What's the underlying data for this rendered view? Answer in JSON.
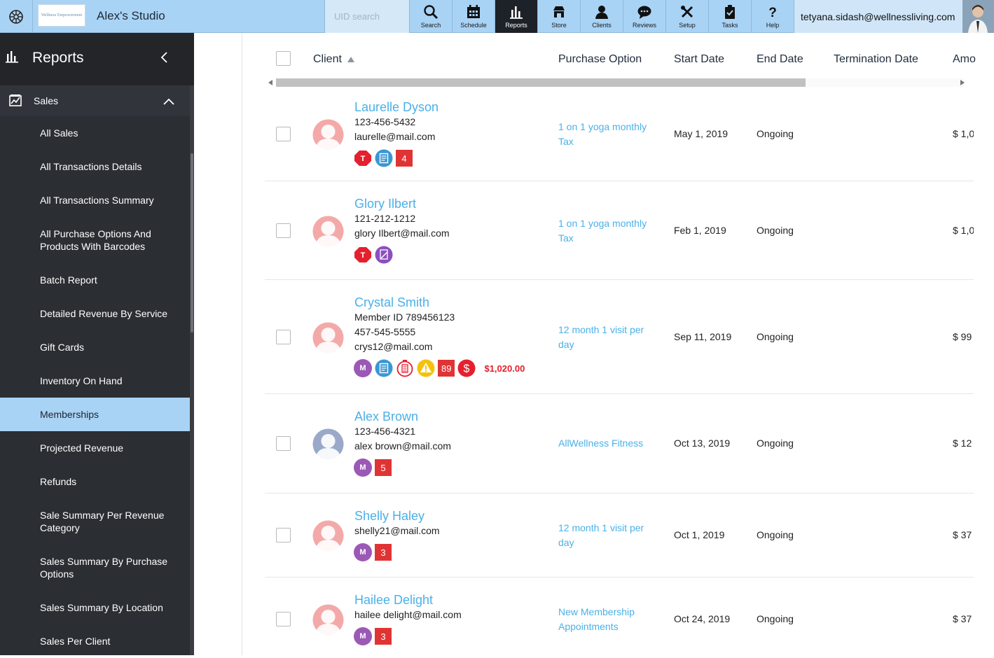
{
  "topbar": {
    "studio_name": "Alex's Studio",
    "logo_text": "Wellness Empowerment",
    "search_placeholder": "UID search",
    "nav": [
      {
        "label": "Search",
        "icon": "search-icon"
      },
      {
        "label": "Schedule",
        "icon": "calendar-icon"
      },
      {
        "label": "Reports",
        "icon": "bar-chart-icon",
        "active": true
      },
      {
        "label": "Store",
        "icon": "store-icon"
      },
      {
        "label": "Clients",
        "icon": "person-icon"
      },
      {
        "label": "Reviews",
        "icon": "speech-bubble-icon"
      },
      {
        "label": "Setup",
        "icon": "tools-icon"
      },
      {
        "label": "Tasks",
        "icon": "clipboard-icon"
      },
      {
        "label": "Help",
        "icon": "question-icon"
      }
    ],
    "user_email": "tetyana.sidash@wellnessliving.com"
  },
  "sidebar": {
    "title": "Reports",
    "section": "Sales",
    "items": [
      {
        "label": "All Sales"
      },
      {
        "label": "All Transactions Details"
      },
      {
        "label": "All Transactions Summary"
      },
      {
        "label": "All Purchase Options And Products With Barcodes"
      },
      {
        "label": "Batch Report"
      },
      {
        "label": "Detailed Revenue By Service"
      },
      {
        "label": "Gift Cards"
      },
      {
        "label": "Inventory On Hand"
      },
      {
        "label": "Memberships",
        "active": true
      },
      {
        "label": "Projected Revenue"
      },
      {
        "label": "Refunds"
      },
      {
        "label": "Sale Summary Per Revenue Category"
      },
      {
        "label": "Sales Summary By Purchase Options"
      },
      {
        "label": "Sales Summary By Location"
      },
      {
        "label": "Sales Per Client"
      }
    ]
  },
  "table": {
    "columns": {
      "client": "Client",
      "purchase_option": "Purchase Option",
      "start_date": "Start Date",
      "end_date": "End Date",
      "termination_date": "Termination Date",
      "amount": "Amo"
    },
    "rows": [
      {
        "name": "Laurelle Dyson",
        "lines": [
          "123-456-5432",
          "laurelle@mail.com"
        ],
        "badges": [
          {
            "type": "tag",
            "icon": "tag-t-icon"
          },
          {
            "type": "note",
            "icon": "note-icon"
          },
          {
            "type": "num",
            "value": "4"
          }
        ],
        "purchase_option": [
          "1 on 1 yoga monthly",
          "Tax"
        ],
        "start_date": "May 1, 2019",
        "end_date": "Ongoing",
        "amount": "$ 1,0",
        "avatar": "female"
      },
      {
        "name": "Glory Ilbert",
        "lines": [
          "121-212-1212",
          "glory Ilbert@mail.com"
        ],
        "badges": [
          {
            "type": "tag",
            "icon": "tag-t-icon"
          },
          {
            "type": "waiver",
            "icon": "signature-icon"
          }
        ],
        "purchase_option": [
          "1 on 1 yoga monthly",
          "Tax"
        ],
        "start_date": "Feb 1, 2019",
        "end_date": "Ongoing",
        "amount": "$ 1,0",
        "avatar": "female"
      },
      {
        "name": "Crystal Smith",
        "lines": [
          "Member ID 789456123",
          "457-545-5555",
          "crys12@mail.com"
        ],
        "badges": [
          {
            "type": "m",
            "value": "M"
          },
          {
            "type": "note",
            "icon": "note-icon"
          },
          {
            "type": "timer",
            "icon": "timer-icon"
          },
          {
            "type": "warn",
            "icon": "warning-icon"
          },
          {
            "type": "num",
            "value": "89"
          },
          {
            "type": "dollar",
            "icon": "dollar-icon"
          }
        ],
        "balance": "$1,020.00",
        "purchase_option": [
          "12 month 1 visit per",
          "day"
        ],
        "start_date": "Sep 11, 2019",
        "end_date": "Ongoing",
        "amount": "$ 99",
        "avatar": "female"
      },
      {
        "name": "Alex Brown",
        "lines": [
          "123-456-4321",
          "alex brown@mail.com"
        ],
        "badges": [
          {
            "type": "m",
            "value": "M"
          },
          {
            "type": "num",
            "value": "5"
          }
        ],
        "purchase_option": [
          "AllWellness Fitness"
        ],
        "start_date": "Oct 13, 2019",
        "end_date": "Ongoing",
        "amount": "$ 12",
        "avatar": "male"
      },
      {
        "name": "Shelly Haley",
        "lines": [
          "shelly21@mail.com"
        ],
        "badges": [
          {
            "type": "m",
            "value": "M"
          },
          {
            "type": "num",
            "value": "3"
          }
        ],
        "purchase_option": [
          "12 month 1 visit per",
          "day"
        ],
        "start_date": "Oct 1, 2019",
        "end_date": "Ongoing",
        "amount": "$ 37",
        "avatar": "female"
      },
      {
        "name": "Hailee Delight",
        "lines": [
          "hailee delight@mail.com"
        ],
        "badges": [
          {
            "type": "m",
            "value": "M"
          },
          {
            "type": "num",
            "value": "3"
          }
        ],
        "purchase_option": [
          "New Membership",
          "Appointments"
        ],
        "start_date": "Oct 24, 2019",
        "end_date": "Ongoing",
        "amount": "$ 37",
        "avatar": "female"
      }
    ]
  },
  "colors": {
    "topbar": "#a9d3f5",
    "sidebar": "#2b2e33",
    "link": "#4ab0e8",
    "badge_red": "#e03434",
    "badge_purple": "#9b59b6"
  }
}
